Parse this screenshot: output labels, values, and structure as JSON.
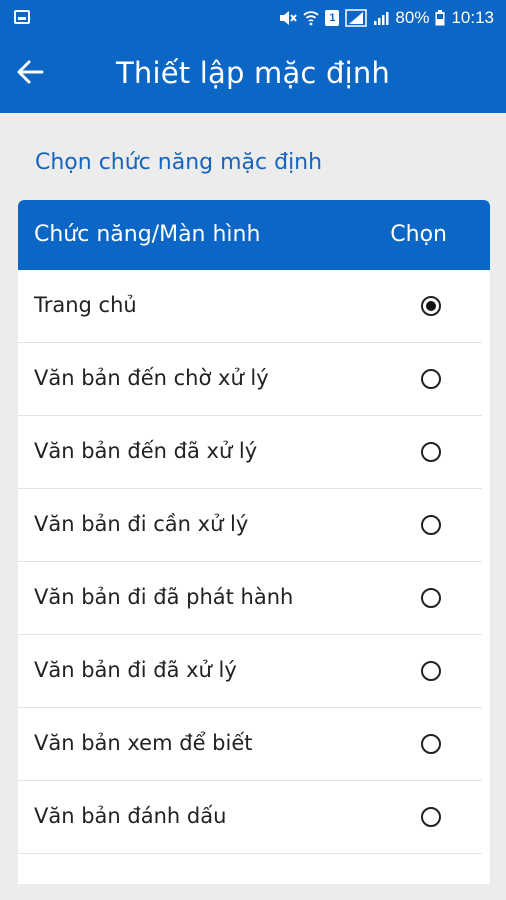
{
  "status_bar": {
    "battery": "80%",
    "time": "10:13",
    "sim": "1"
  },
  "header": {
    "title": "Thiết lập mặc định"
  },
  "section_title": "Chọn chức năng mặc định",
  "table": {
    "col_function": "Chức năng/Màn hình",
    "col_choose": "Chọn",
    "rows": [
      {
        "label": "Trang chủ",
        "selected": true
      },
      {
        "label": "Văn bản đến chờ xử lý",
        "selected": false
      },
      {
        "label": "Văn bản đến đã xử lý",
        "selected": false
      },
      {
        "label": "Văn bản đi cần xử lý",
        "selected": false
      },
      {
        "label": "Văn bản đi đã phát hành",
        "selected": false
      },
      {
        "label": "Văn bản đi đã xử lý",
        "selected": false
      },
      {
        "label": "Văn bản xem để biết",
        "selected": false
      },
      {
        "label": "Văn bản đánh dấu",
        "selected": false
      }
    ]
  }
}
